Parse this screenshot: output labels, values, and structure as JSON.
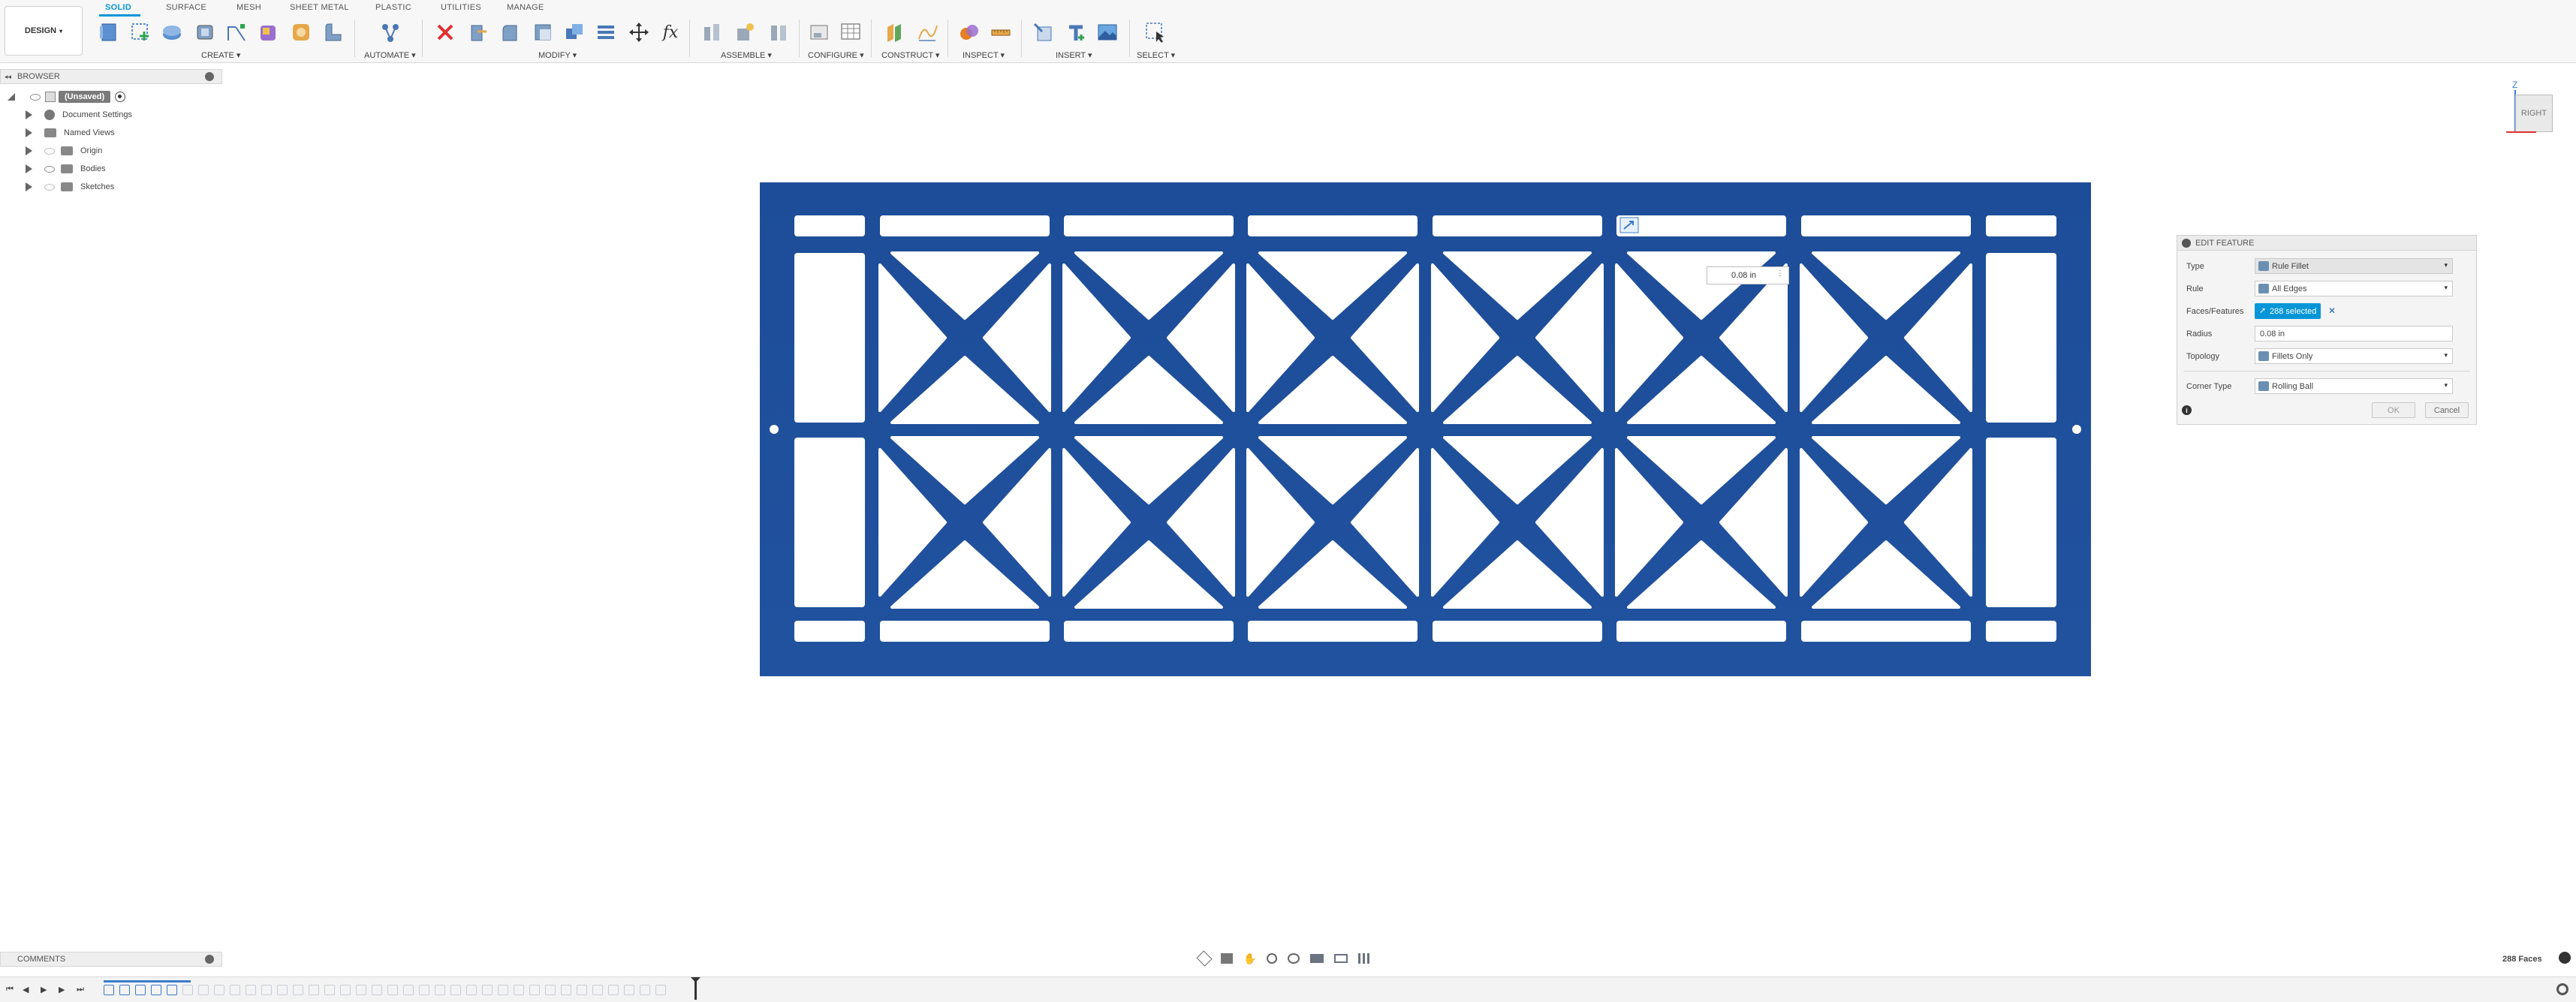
{
  "toolbar": {
    "design_label": "DESIGN",
    "tabs": [
      "SOLID",
      "SURFACE",
      "MESH",
      "SHEET METAL",
      "PLASTIC",
      "UTILITIES",
      "MANAGE"
    ],
    "groups": [
      "CREATE",
      "AUTOMATE",
      "MODIFY",
      "ASSEMBLE",
      "CONFIGURE",
      "CONSTRUCT",
      "INSPECT",
      "INSERT",
      "SELECT"
    ],
    "dropdown_glyph": "▾",
    "accent_color": "#0696d7"
  },
  "browser": {
    "title": "BROWSER",
    "root": "(Unsaved)",
    "items": [
      "Document Settings",
      "Named Views",
      "Origin",
      "Bodies",
      "Sketches"
    ]
  },
  "viewcube": {
    "face": "RIGHT",
    "axis_z": "Z"
  },
  "canvas": {
    "part_color": "#1f4f99",
    "radius_tag": "0.08 in"
  },
  "edit_feature": {
    "title": "EDIT FEATURE",
    "rows": [
      {
        "label": "Type",
        "value": "Rule Fillet"
      },
      {
        "label": "Rule",
        "value": "All Edges"
      },
      {
        "label": "Faces/Features",
        "value": "288 selected"
      },
      {
        "label": "Radius",
        "value": "0.08 in"
      },
      {
        "label": "Topology",
        "value": "Fillets Only"
      },
      {
        "label": "Corner Type",
        "value": "Rolling Ball"
      }
    ],
    "ok_label": "OK",
    "cancel_label": "Cancel",
    "clear_glyph": "✕"
  },
  "comments": {
    "label": "COMMENTS"
  },
  "status": {
    "selection_count": "288 Faces"
  }
}
